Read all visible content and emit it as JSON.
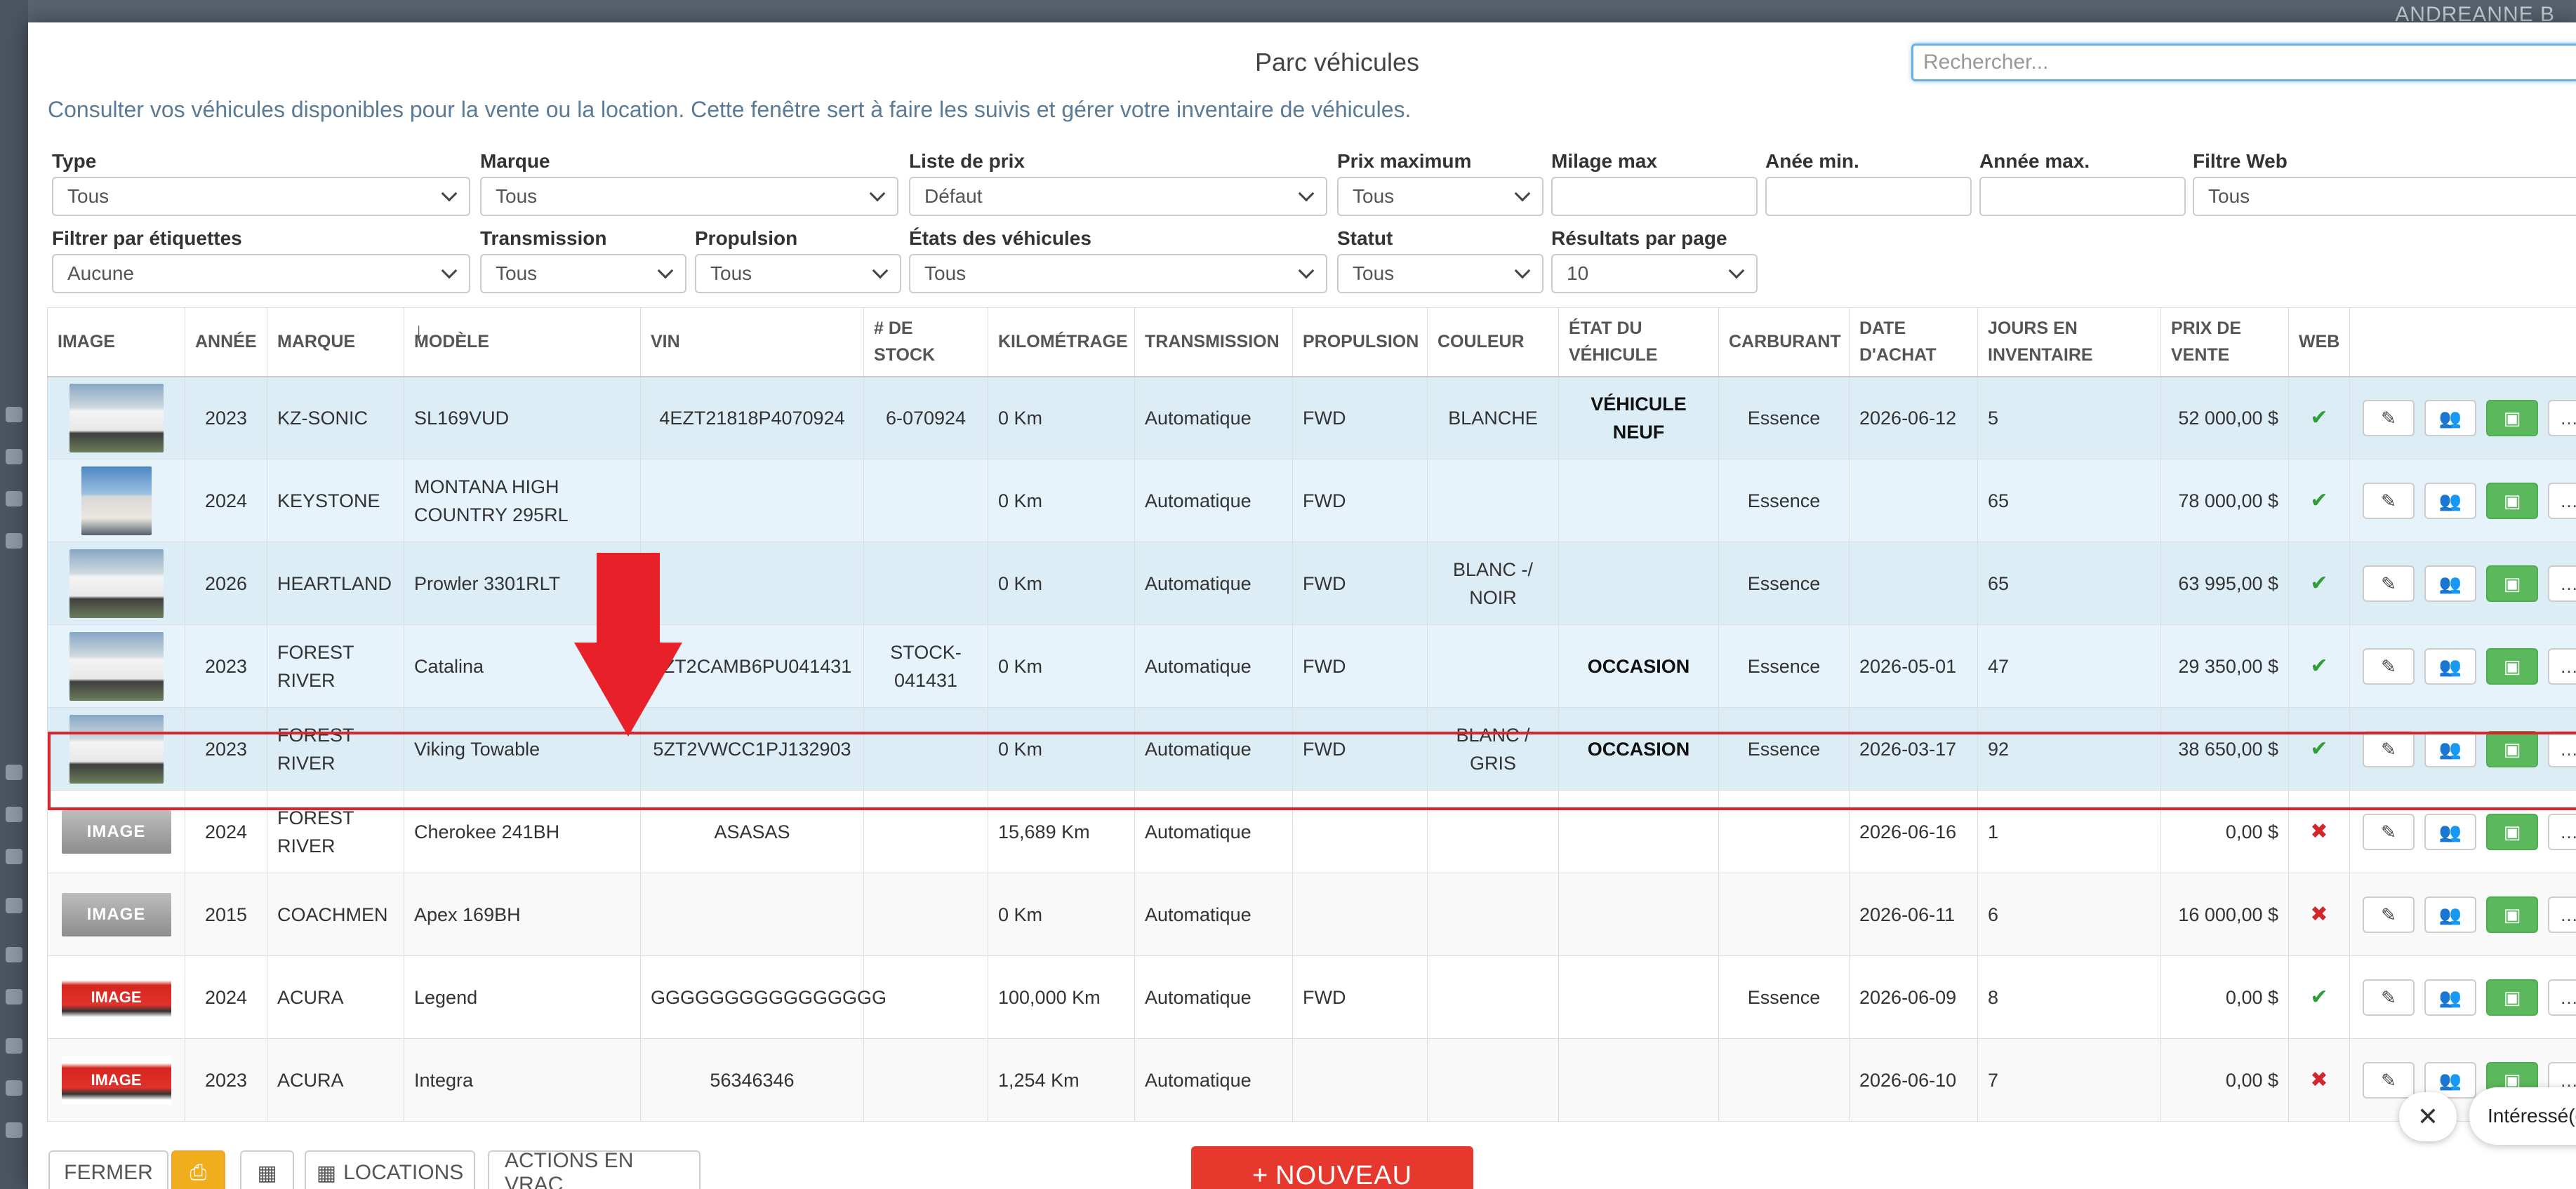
{
  "app": {
    "user_name": "ANDREANNE B"
  },
  "modal": {
    "title": "Parc véhicules",
    "search_placeholder": "Rechercher...",
    "intro": "Consulter vos véhicules disponibles pour la vente ou la location. Cette fenêtre sert à faire les suivis et gérer votre inventaire de véhicules."
  },
  "filters": {
    "type": {
      "label": "Type",
      "value": "Tous"
    },
    "brand": {
      "label": "Marque",
      "value": "Tous"
    },
    "price_list": {
      "label": "Liste de prix",
      "value": "Défaut"
    },
    "max_price": {
      "label": "Prix maximum",
      "value": "Tous"
    },
    "max_mileage": {
      "label": "Milage max",
      "value": ""
    },
    "min_year": {
      "label": "Anée min.",
      "value": ""
    },
    "max_year": {
      "label": "Année max.",
      "value": ""
    },
    "web_filter": {
      "label": "Filtre Web",
      "value": "Tous"
    },
    "tags": {
      "label": "Filtrer par étiquettes",
      "value": "Aucune"
    },
    "transmission": {
      "label": "Transmission",
      "value": "Tous"
    },
    "propulsion": {
      "label": "Propulsion",
      "value": "Tous"
    },
    "vehicle_states": {
      "label": "États des véhicules",
      "value": "Tous"
    },
    "status": {
      "label": "Statut",
      "value": "Tous"
    },
    "per_page": {
      "label": "Résultats par page",
      "value": "10"
    }
  },
  "table": {
    "headers": {
      "image": "Image",
      "year": "Année",
      "brand": "Marque",
      "model": "Modèle",
      "vin": "VIN",
      "stock": "# de stock",
      "km": "Kilométrage",
      "transmission": "Transmission",
      "propulsion": "Propulsion",
      "color": "Couleur",
      "state": "État du véhicule",
      "fuel": "Carburant",
      "purchase_date": "Date d'achat",
      "days": "Jours en inventaire",
      "price": "Prix de vente",
      "web": "Web"
    },
    "image_placeholder_text": "IMAGE",
    "rows": [
      {
        "year": "2023",
        "brand": "KZ-SONIC",
        "model": "SL169VUD",
        "vin": "4EZT21818P4070924",
        "stock": "6-070924",
        "km": "0 Km",
        "transmission": "Automatique",
        "propulsion": "FWD",
        "color": "BLANCHE",
        "state": "VÉHICULE NEUF",
        "fuel": "Essence",
        "purchase_date": "2026-06-12",
        "days": "5",
        "price": "52 000,00 $",
        "web": true
      },
      {
        "year": "2024",
        "brand": "KEYSTONE",
        "model": "MONTANA HIGH COUNTRY 295RL",
        "vin": "",
        "stock": "",
        "km": "0 Km",
        "transmission": "Automatique",
        "propulsion": "FWD",
        "color": "",
        "state": "",
        "fuel": "Essence",
        "purchase_date": "",
        "days": "65",
        "price": "78 000,00 $",
        "web": true
      },
      {
        "year": "2026",
        "brand": "HEARTLAND",
        "model": "Prowler 3301RLT",
        "vin": "",
        "stock": "",
        "km": "0 Km",
        "transmission": "Automatique",
        "propulsion": "FWD",
        "color": "BLANC -/ NOIR",
        "state": "",
        "fuel": "Essence",
        "purchase_date": "",
        "days": "65",
        "price": "63 995,00 $",
        "web": true
      },
      {
        "year": "2023",
        "brand": "FOREST RIVER",
        "model": "Catalina",
        "vin": "5ZT2CAMB6PU041431",
        "stock": "STOCK-041431",
        "km": "0 Km",
        "transmission": "Automatique",
        "propulsion": "FWD",
        "color": "",
        "state": "OCCASION",
        "fuel": "Essence",
        "purchase_date": "2026-05-01",
        "days": "47",
        "price": "29 350,00 $",
        "web": true
      },
      {
        "year": "2023",
        "brand": "FOREST RIVER",
        "model": "Viking Towable",
        "vin": "5ZT2VWCC1PJ132903",
        "stock": "",
        "km": "0 Km",
        "transmission": "Automatique",
        "propulsion": "FWD",
        "color": "BLANC / GRIS",
        "state": "OCCASION",
        "fuel": "Essence",
        "purchase_date": "2026-03-17",
        "days": "92",
        "price": "38 650,00 $",
        "web": true
      },
      {
        "year": "2024",
        "brand": "FOREST RIVER",
        "model": "Cherokee 241BH",
        "vin": "ASASAS",
        "stock": "",
        "km": "15,689 Km",
        "transmission": "Automatique",
        "propulsion": "",
        "color": "",
        "state": "",
        "fuel": "",
        "purchase_date": "2026-06-16",
        "days": "1",
        "price": "0,00 $",
        "web": false
      },
      {
        "year": "2015",
        "brand": "COACHMEN",
        "model": "Apex 169BH",
        "vin": "",
        "stock": "",
        "km": "0 Km",
        "transmission": "Automatique",
        "propulsion": "",
        "color": "",
        "state": "",
        "fuel": "",
        "purchase_date": "2026-06-11",
        "days": "6",
        "price": "16 000,00 $",
        "web": false
      },
      {
        "year": "2024",
        "brand": "ACURA",
        "model": "Legend",
        "vin": "GGGGGGGGGGGGGGGG",
        "stock": "",
        "km": "100,000 Km",
        "transmission": "Automatique",
        "propulsion": "FWD",
        "color": "",
        "state": "",
        "fuel": "Essence",
        "purchase_date": "2026-06-09",
        "days": "8",
        "price": "0,00 $",
        "web": true
      },
      {
        "year": "2023",
        "brand": "ACURA",
        "model": "Integra",
        "vin": "56346346",
        "stock": "",
        "km": "1,254 Km",
        "transmission": "Automatique",
        "propulsion": "",
        "color": "",
        "state": "",
        "fuel": "",
        "purchase_date": "2026-06-10",
        "days": "7",
        "price": "0,00 $",
        "web": false
      }
    ]
  },
  "footer": {
    "close": "FERMER",
    "locations": "LOCATIONS",
    "bulk_actions": "ACTIONS EN VRAC",
    "new": "NOUVEAU"
  },
  "toast": {
    "text": "Intéressé(e)/Intéressée(s)"
  },
  "colors": {
    "accent_red": "#e7382d",
    "highlight_border": "#d9262c",
    "yellow": "#f0ad1c",
    "green": "#5cb85c",
    "row_blue": "#ddedf6"
  }
}
